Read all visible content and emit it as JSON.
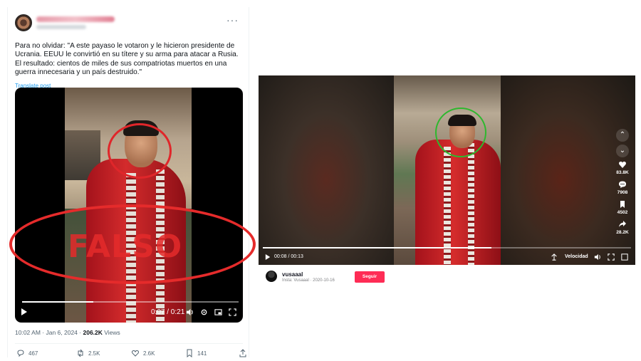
{
  "tweet": {
    "text": "Para no olvidar: \"A este payaso le votaron y le hicieron presidente de Ucrania. EEUU le convirtió en su títere y su arma para atacar a Rusia. El resultado: cientos de miles de sus compatriotas muertos en una guerra innecesaria y un país destruido.\"",
    "translate_label": "Translate post",
    "overlay_text": "FALSO",
    "video": {
      "time": "0:07 / 0:21",
      "progress": 0.33
    },
    "timestamp": "10:02 AM · Jan 6, 2024",
    "views_count": "206.2K",
    "views_label": "Views",
    "actions": {
      "replies": "467",
      "reposts": "2.5K",
      "likes": "2.6K",
      "bookmarks": "141"
    }
  },
  "tiktok": {
    "rail": {
      "likes": "83.8K",
      "comments": "7908",
      "saves": "4502",
      "shares": "28.2K"
    },
    "time": "00:08 / 00:13",
    "progress": 0.62,
    "speed_label": "Velocidad",
    "username": "vusaaal",
    "subline": "Insta: Vusaaal · 2020-10-16",
    "follow_label": "Seguir"
  },
  "colors": {
    "falso_red": "#e52b2b",
    "highlight_green": "#2eb82e",
    "link_blue": "#1d9bf0",
    "tiktok_pink": "#fe2c55"
  },
  "icons": [
    "more-icon",
    "play-icon",
    "volume-icon",
    "settings-icon",
    "pip-icon",
    "fullscreen-icon",
    "reply-icon",
    "repost-icon",
    "like-icon",
    "bookmark-icon",
    "share-icon",
    "chevron-up-icon",
    "chevron-down-icon",
    "heart-icon",
    "comment-icon",
    "save-icon",
    "forward-icon",
    "autoplay-icon"
  ]
}
